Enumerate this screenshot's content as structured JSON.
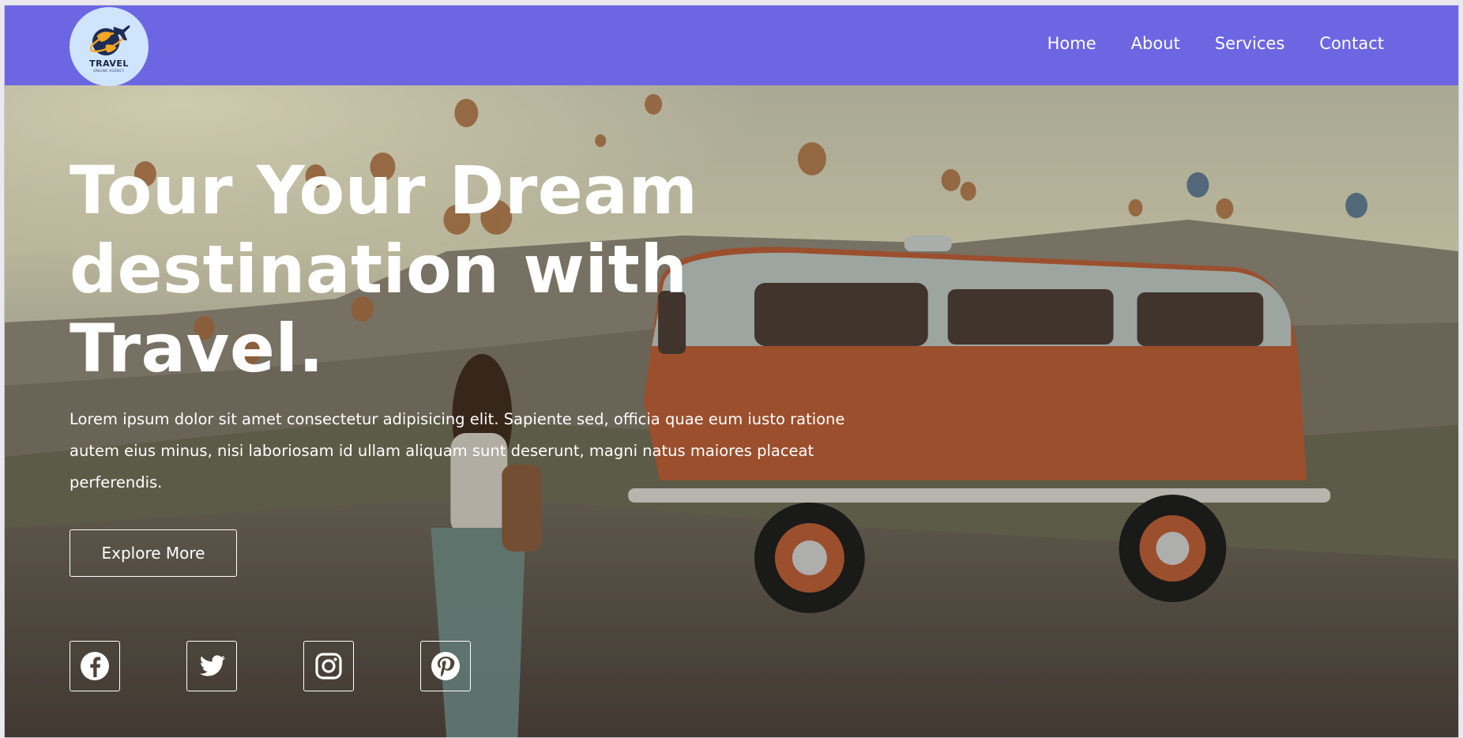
{
  "logo": {
    "title": "TRAVEL",
    "subtitle": "ONLINE AGENCY"
  },
  "nav": {
    "items": [
      "Home",
      "About",
      "Services",
      "Contact"
    ]
  },
  "hero": {
    "title_line1": "Tour Your Dream",
    "title_line2": "destination with",
    "title_line3": "Travel.",
    "paragraph": "Lorem ipsum dolor sit amet consectetur adipisicing elit. Sapiente sed, officia quae eum iusto ratione autem eius minus, nisi laboriosam id ullam aliquam sunt deserunt, magni natus maiores placeat perferendis.",
    "button_label": "Explore More"
  },
  "socials": [
    "facebook-icon",
    "twitter-icon",
    "instagram-icon",
    "pinterest-icon"
  ],
  "colors": {
    "header": "#6c66e3",
    "logo_bg": "#cfe4ff",
    "text": "#ffffff",
    "van": "#b85b33"
  }
}
